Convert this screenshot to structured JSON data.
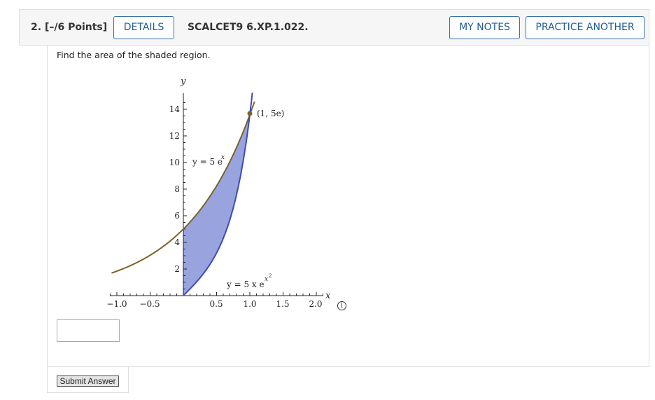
{
  "header": {
    "question_number": "2.",
    "points": "[–/6 Points]",
    "details_label": "DETAILS",
    "question_code": "SCALCET9 6.XP.1.022.",
    "my_notes_label": "MY NOTES",
    "practice_label": "PRACTICE ANOTHER",
    "accent_color": "#215e9c"
  },
  "question": {
    "prompt": "Find the area of the shaded region.",
    "answer_value": "",
    "submit_label": "Submit Answer",
    "info_icon": "info-icon"
  },
  "graph": {
    "y_label": "y",
    "x_label": "x",
    "y_ticks": [
      "14",
      "12",
      "10",
      "8",
      "6",
      "4",
      "2"
    ],
    "x_ticks": [
      "−1.0",
      "−0.5",
      "0.5",
      "1.0",
      "1.5",
      "2.0"
    ],
    "point_label": "(1, 5e)",
    "upper_curve_label": "y = 5 e",
    "upper_curve_exponent": "x",
    "lower_curve_label": "y = 5 x e",
    "lower_curve_exponent": "x",
    "lower_curve_exponent_power": "2",
    "fill_color": "#99a3de",
    "upper_curve_color": "#7a6428",
    "lower_curve_color": "#3c4ac0"
  }
}
